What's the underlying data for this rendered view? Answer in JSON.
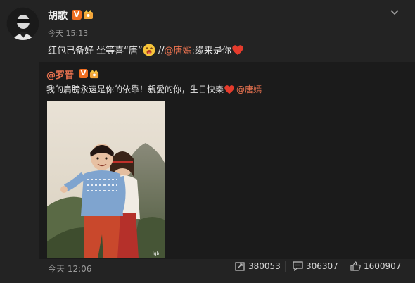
{
  "post": {
    "author": "胡歌",
    "timestamp": "今天 15:13",
    "text_before": "红包已备好 坐等喜“唐”",
    "text_mid": " //",
    "mention": "@唐嫣",
    "text_after": ":缘来是你"
  },
  "repost": {
    "author": "@罗晋",
    "text": "我的肩膀永遠是你的依靠！親愛的你，生日快樂",
    "mention": "@唐嫣",
    "photo_watermark": "lgb"
  },
  "footer": {
    "time": "今天 12:06",
    "reposts": "380053",
    "comments": "306307",
    "likes": "1600907"
  },
  "colors": {
    "background": "#232323",
    "repost_background": "#1b1b1b",
    "mention": "#eb7350",
    "verified_badge": "#ef6d20"
  },
  "icons": {
    "verified": "verified-v-icon",
    "member": "crown-member-icon",
    "menu": "chevron-down-icon",
    "repost": "repost-icon",
    "comment": "comment-icon",
    "like": "thumbs-up-icon"
  }
}
